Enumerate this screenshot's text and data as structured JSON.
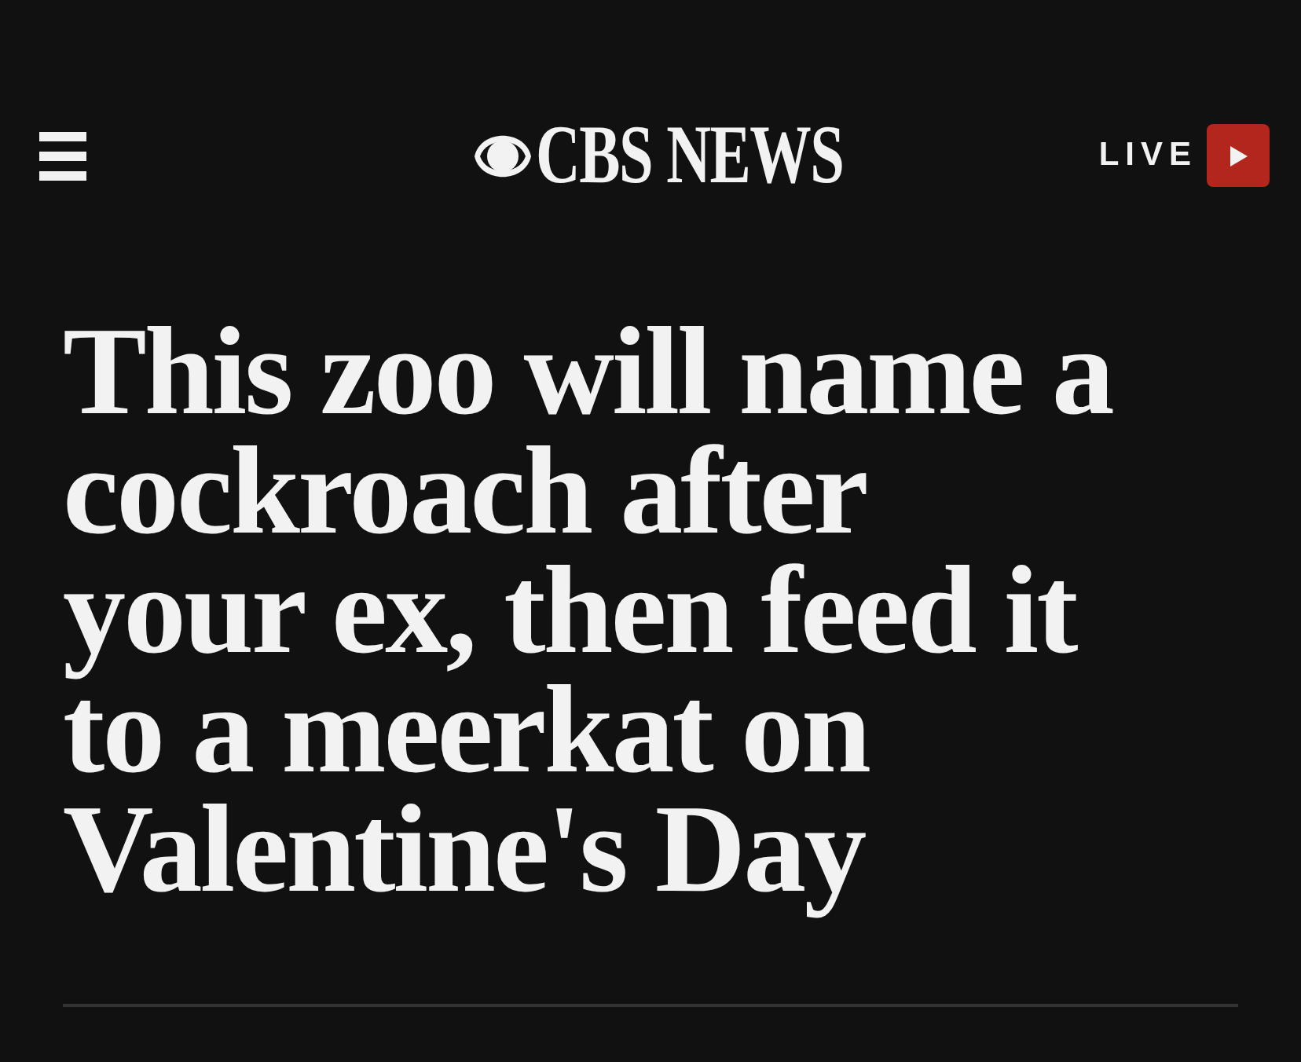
{
  "header": {
    "logo": "CBS NEWS",
    "live_label": "LIVE"
  },
  "article": {
    "headline_lines": [
      "This zoo will name a",
      "cockroach after",
      "your ex, then feed it",
      "to a meerkat on",
      "Valentine's Day"
    ]
  }
}
